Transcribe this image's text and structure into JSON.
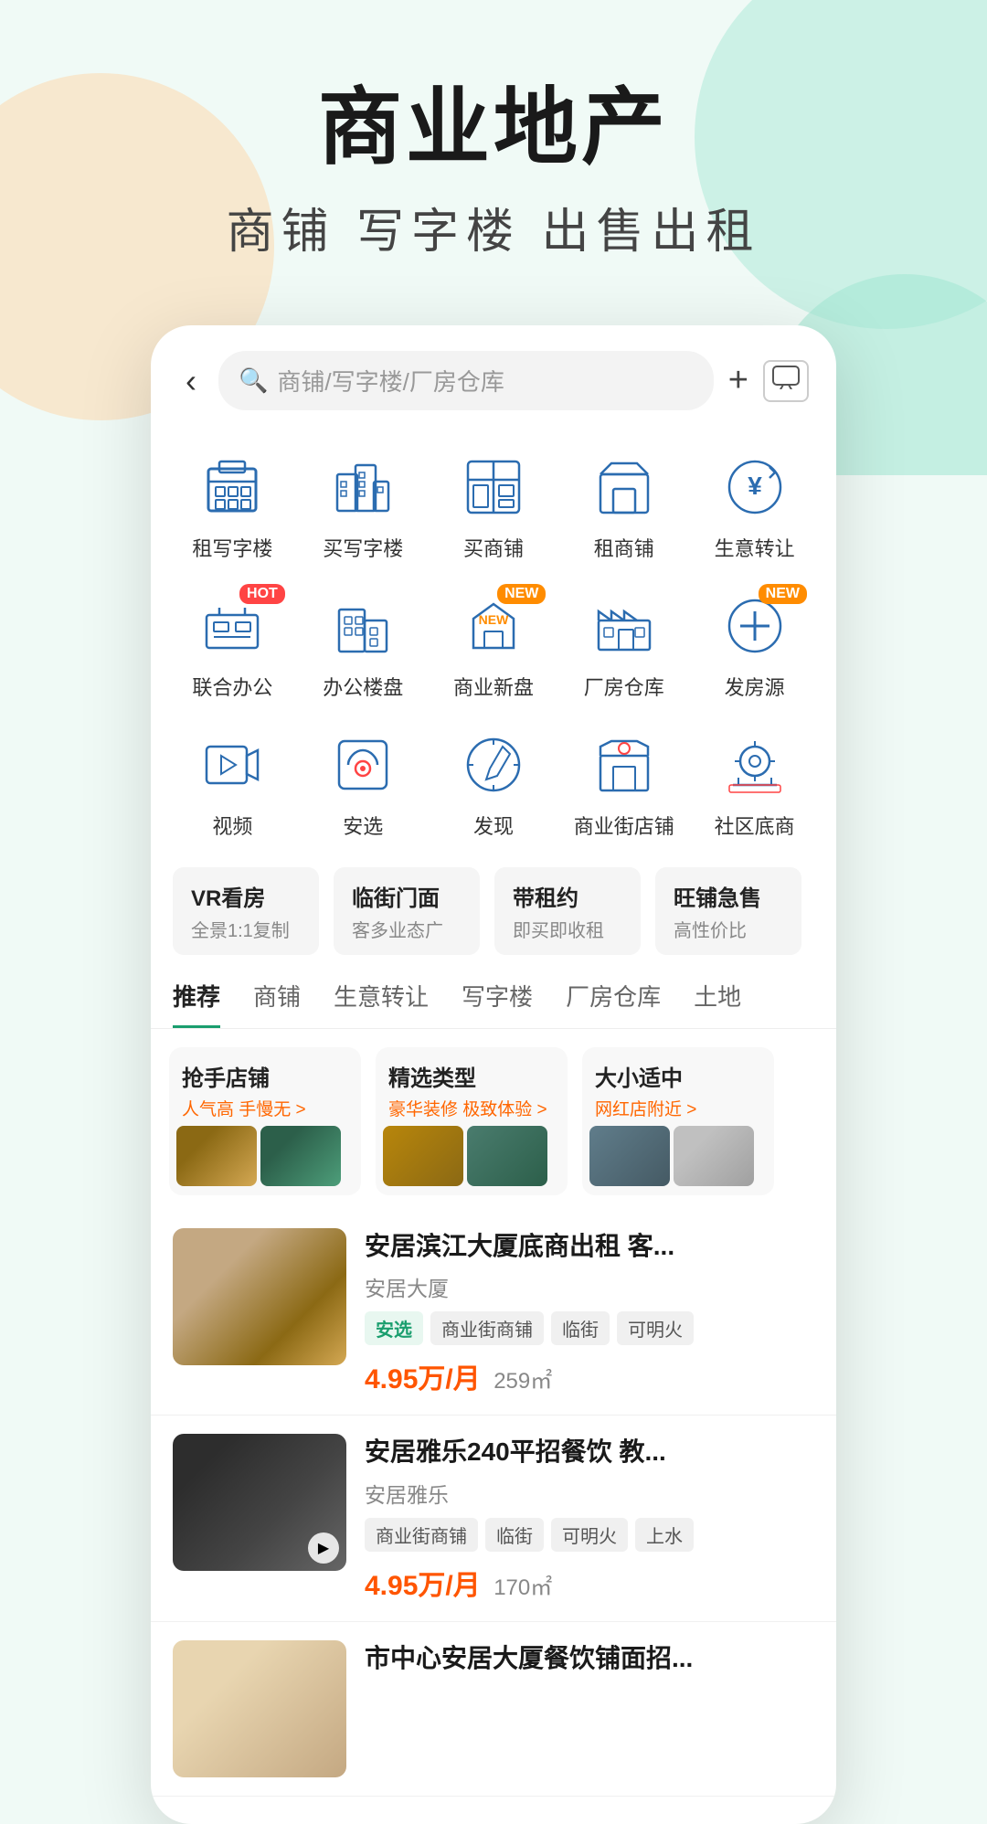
{
  "hero": {
    "title": "商业地产",
    "subtitle": "商铺  写字楼  出售出租"
  },
  "search": {
    "placeholder": "商铺/写字楼/厂房仓库",
    "back_label": "‹",
    "plus_label": "+",
    "msg_label": "⊡"
  },
  "categories": [
    {
      "id": "rent-office",
      "label": "租写字楼",
      "icon": "building",
      "badge": null
    },
    {
      "id": "buy-office",
      "label": "买写字楼",
      "icon": "chart-building",
      "badge": null
    },
    {
      "id": "buy-shop",
      "label": "买商铺",
      "icon": "grid-building",
      "badge": null
    },
    {
      "id": "rent-shop",
      "label": "租商铺",
      "icon": "store",
      "badge": null
    },
    {
      "id": "business-transfer",
      "label": "生意转让",
      "icon": "yen-circle",
      "badge": null
    },
    {
      "id": "coworking",
      "label": "联合办公",
      "icon": "desk",
      "badge": "HOT"
    },
    {
      "id": "office-complex",
      "label": "办公楼盘",
      "icon": "office-complex",
      "badge": null
    },
    {
      "id": "commercial-new",
      "label": "商业新盘",
      "icon": "new-building",
      "badge": "NEW"
    },
    {
      "id": "factory",
      "label": "厂房仓库",
      "icon": "warehouse",
      "badge": null
    },
    {
      "id": "post-source",
      "label": "发房源",
      "icon": "plus-circle",
      "badge": "NEW"
    },
    {
      "id": "video",
      "label": "视频",
      "icon": "video",
      "badge": null
    },
    {
      "id": "an-select",
      "label": "安选",
      "icon": "an-select",
      "badge": null
    },
    {
      "id": "discover",
      "label": "发现",
      "icon": "compass",
      "badge": null
    },
    {
      "id": "commercial-street",
      "label": "商业街店铺",
      "icon": "shop-face",
      "badge": null
    },
    {
      "id": "community-shop",
      "label": "社区底商",
      "icon": "community",
      "badge": null
    }
  ],
  "feature_tags": [
    {
      "id": "vr",
      "title": "VR看房",
      "sub": "全景1:1复制"
    },
    {
      "id": "street-front",
      "title": "临街门面",
      "sub": "客多业态广"
    },
    {
      "id": "with-lease",
      "title": "带租约",
      "sub": "即买即收租"
    },
    {
      "id": "hot-shop",
      "title": "旺铺急售",
      "sub": "高性价比"
    }
  ],
  "tabs": [
    {
      "id": "recommend",
      "label": "推荐",
      "active": true
    },
    {
      "id": "shop",
      "label": "商铺",
      "active": false
    },
    {
      "id": "business-transfer",
      "label": "生意转让",
      "active": false
    },
    {
      "id": "office",
      "label": "写字楼",
      "active": false
    },
    {
      "id": "factory",
      "label": "厂房仓库",
      "active": false
    },
    {
      "id": "land",
      "label": "土地",
      "active": false
    }
  ],
  "promo_cards": [
    {
      "id": "grab-shop",
      "title": "抢手店铺",
      "sub": "人气高 手慢无 >",
      "imgs": [
        "img-shop1",
        "img-shop2"
      ]
    },
    {
      "id": "selected-type",
      "title": "精选类型",
      "sub": "豪华装修 极致体验 >",
      "imgs": [
        "img-promo1",
        "img-promo2"
      ]
    },
    {
      "id": "right-size",
      "title": "大小适中",
      "sub": "网红店附近 >",
      "imgs": [
        "img-promo3",
        "img-shop3"
      ]
    }
  ],
  "listings": [
    {
      "id": "listing-1",
      "title": "安居滨江大厦底商出租 客...",
      "location": "安居大厦",
      "tags": [
        {
          "text": "安选",
          "type": "green"
        },
        {
          "text": "商业街商铺",
          "type": "gray"
        },
        {
          "text": "临街",
          "type": "gray"
        },
        {
          "text": "可明火",
          "type": "gray"
        }
      ],
      "price": "4.95万/月",
      "area": "259㎡",
      "img_class": "img-listing1",
      "has_video": false
    },
    {
      "id": "listing-2",
      "title": "安居雅乐240平招餐饮 教...",
      "location": "安居雅乐",
      "tags": [
        {
          "text": "商业街商铺",
          "type": "gray"
        },
        {
          "text": "临街",
          "type": "gray"
        },
        {
          "text": "可明火",
          "type": "gray"
        },
        {
          "text": "上水",
          "type": "gray"
        }
      ],
      "price": "4.95万/月",
      "area": "170㎡",
      "img_class": "img-listing2",
      "has_video": true
    },
    {
      "id": "listing-3",
      "title": "市中心安居大厦餐饮铺面招...",
      "location": "",
      "tags": [],
      "price": "",
      "area": "",
      "img_class": "img-listing3",
      "has_video": false
    }
  ]
}
